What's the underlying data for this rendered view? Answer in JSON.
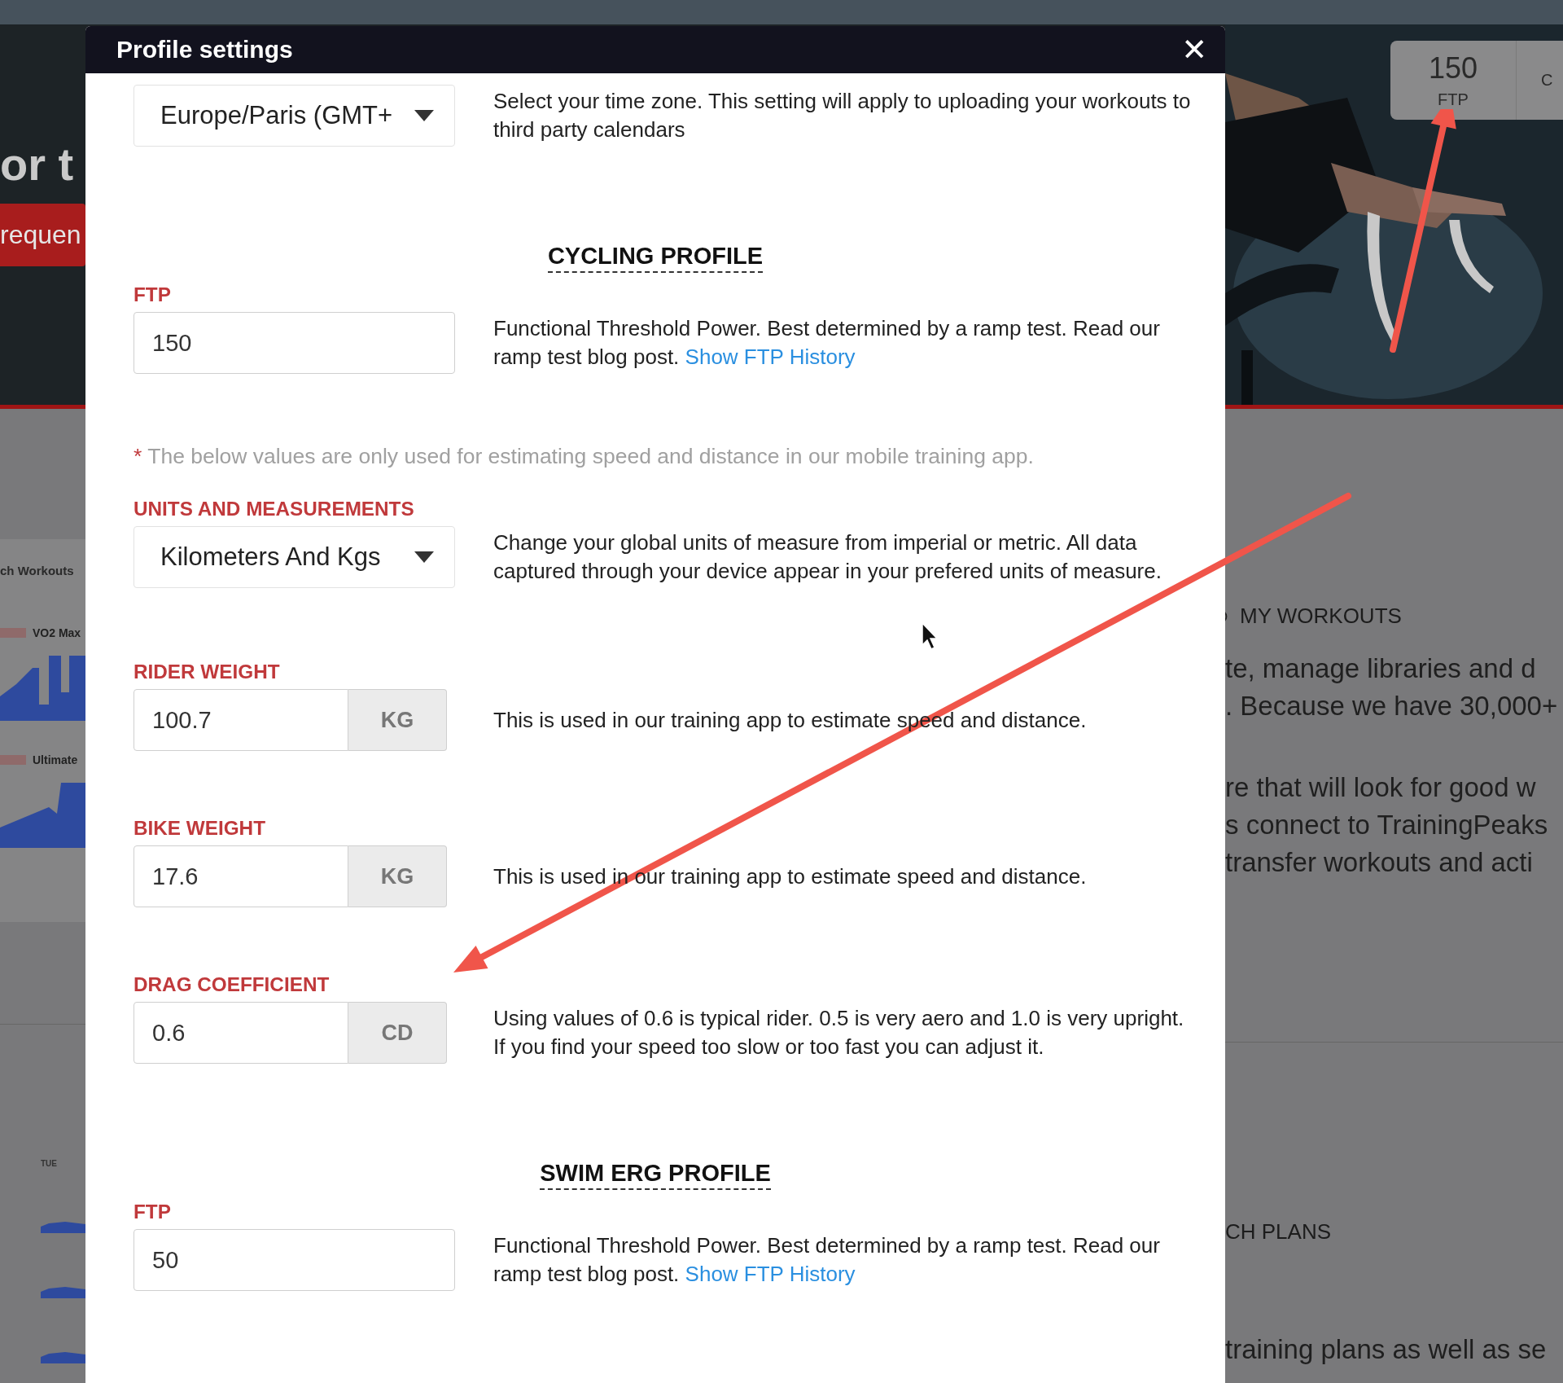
{
  "page": {
    "hero_heading": "or t",
    "hero_button": "requen",
    "stats": [
      {
        "value": "150",
        "label": "FTP"
      },
      {
        "label": "C"
      }
    ],
    "left_card": {
      "title": "ch Workouts",
      "workouts": [
        "VO2 Max",
        "Ultimate"
      ]
    },
    "calendar": {
      "day": "TUE"
    },
    "right": {
      "section_title": "MY WORKOUTS",
      "paragraphs": [
        [
          "te, manage libraries and d",
          ". Because we have 30,000+"
        ],
        [
          "re that will look for good w",
          "s connect to TrainingPeaks",
          "transfer workouts and acti"
        ]
      ],
      "section_title_2": "CH PLANS",
      "paragraph_2": "training plans as well as se"
    }
  },
  "modal": {
    "title": "Profile settings",
    "close": "✕",
    "items": [
      {
        "kind": "select",
        "value": "Europe/Paris (GMT+",
        "description": "Select your time zone. This setting will apply to uploading your workouts to third party calendars"
      },
      {
        "kind": "heading",
        "text": "CYCLING PROFILE"
      },
      {
        "kind": "field",
        "label": "FTP",
        "value": "150",
        "description": "Functional Threshold Power. Best determined by a ramp test. Read our ramp test blog post.",
        "link": "Show FTP History"
      },
      {
        "kind": "note",
        "marker": "*",
        "text": "The below values are only used for estimating speed and distance in our mobile training app."
      },
      {
        "kind": "select",
        "label": "UNITS AND MEASUREMENTS",
        "value": "Kilometers And Kgs",
        "description": "Change your global units of measure from imperial or metric. All data captured through your device appear in your prefered units of measure."
      },
      {
        "kind": "addon",
        "label": "RIDER WEIGHT",
        "value": "100.7",
        "unit": "KG",
        "description": "This is used in our training app to estimate speed and distance."
      },
      {
        "kind": "addon",
        "label": "BIKE WEIGHT",
        "value": "17.6",
        "unit": "KG",
        "description": "This is used in our training app to estimate speed and distance."
      },
      {
        "kind": "addon",
        "label": "DRAG COEFFICIENT",
        "value": "0.6",
        "unit": "CD",
        "description": "Using values of 0.6 is typical rider. 0.5 is very aero and 1.0 is very upright. If you find your speed too slow or too fast you can adjust it."
      },
      {
        "kind": "heading",
        "text": "SWIM ERG PROFILE"
      },
      {
        "kind": "field",
        "label": "FTP",
        "value": "50",
        "description": "Functional Threshold Power. Best determined by a ramp test. Read our ramp test blog post.",
        "link": "Show FTP History"
      }
    ]
  }
}
